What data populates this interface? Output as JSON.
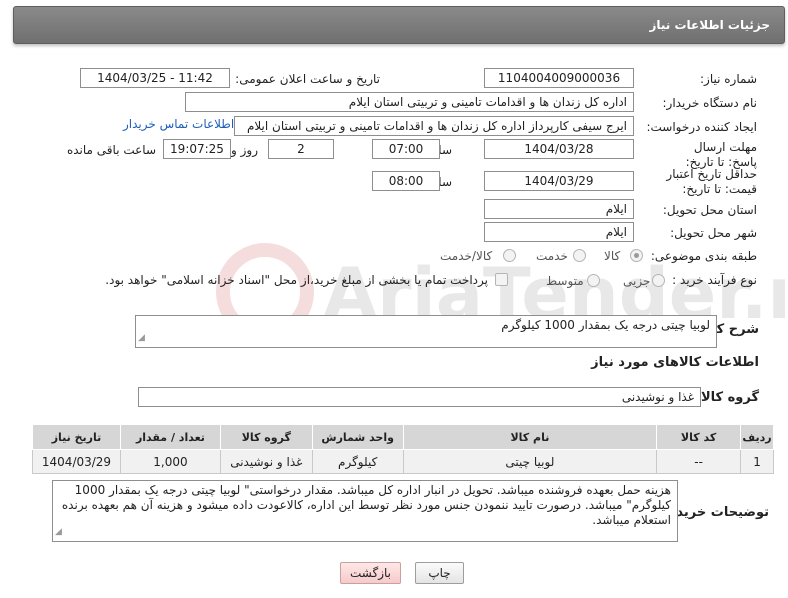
{
  "header": {
    "title": "جزئیات اطلاعات نیاز"
  },
  "labels": {
    "need_number": "شماره نیاز:",
    "announce_datetime": "تاریخ و ساعت اعلان عمومی:",
    "buyer_org": "نام دستگاه خریدار:",
    "requester": "ایجاد کننده درخواست:",
    "reply_deadline": "مهلت ارسال پاسخ: تا تاریخ:",
    "hour1": "ساعت",
    "day": "روز و",
    "remaining": "ساعت باقی مانده",
    "price_validity": "حداقل تاریخ اعتبار قیمت: تا تاریخ:",
    "hour2": "ساعت",
    "province": "استان محل تحویل:",
    "city": "شهر محل تحویل:",
    "category": "طبقه بندی موضوعی:",
    "process_type": "نوع فرآیند خرید :",
    "description": "شرح کلی نیاز:",
    "goods_info": "اطلاعات کالاهای مورد نیاز",
    "goods_group": "گروه کالا:",
    "buyer_notes": "توضیحات خریدار:"
  },
  "values": {
    "need_number": "1104004009000036",
    "announce_datetime": "1404/03/25 - 11:42",
    "buyer_org": "اداره کل زندان ها و اقدامات تامینی و تربیتی استان ایلام",
    "requester": "ایرج  سیفی کارپرداز اداره کل زندان ها و اقدامات تامینی و تربیتی استان ایلام",
    "contact_link": "اطلاعات تماس خریدار",
    "reply_date": "1404/03/28",
    "reply_time": "07:00",
    "days": "2",
    "remaining_time": "19:07:25",
    "validity_date": "1404/03/29",
    "validity_time": "08:00",
    "province": "ایلام",
    "city": "ایلام",
    "description": "لوبیا چیتی درجه یک بمقدار 1000 کیلوگرم",
    "goods_group": "غذا و نوشیدنی",
    "buyer_notes": "هزینه حمل بعهده فروشنده میباشد. تحویل در انبار اداره کل میباشد. مقدار درخواستی\" لوبیا چیتی درجه یک بمقدار 1000 کیلوگرم\" میباشد. درصورت تایید ننمودن جنس مورد نظر توسط این اداره، کالاعودت داده میشود و هزینه آن هم بعهده برنده استعلام میباشد."
  },
  "category_options": [
    {
      "label": "کالا",
      "selected": true
    },
    {
      "label": "خدمت",
      "selected": false
    },
    {
      "label": "کالا/خدمت",
      "selected": false
    }
  ],
  "process_options": [
    {
      "label": "جزیی",
      "selected": false
    },
    {
      "label": "متوسط",
      "selected": false
    }
  ],
  "payment_note": "پرداخت تمام یا بخشی از مبلغ خرید،از محل \"اسناد خزانه اسلامی\" خواهد بود.",
  "table": {
    "headers": [
      "ردیف",
      "کد کالا",
      "نام کالا",
      "واحد شمارش",
      "گروه کالا",
      "تعداد / مقدار",
      "تاریخ نیاز"
    ],
    "rows": [
      [
        "1",
        "--",
        "لوبیا چیتی",
        "کیلوگرم",
        "غذا و نوشیدنی",
        "1,000",
        "1404/03/29"
      ]
    ]
  },
  "buttons": {
    "print": "چاپ",
    "back": "بازگشت"
  },
  "watermark": {
    "text": "AriaTender.net"
  }
}
